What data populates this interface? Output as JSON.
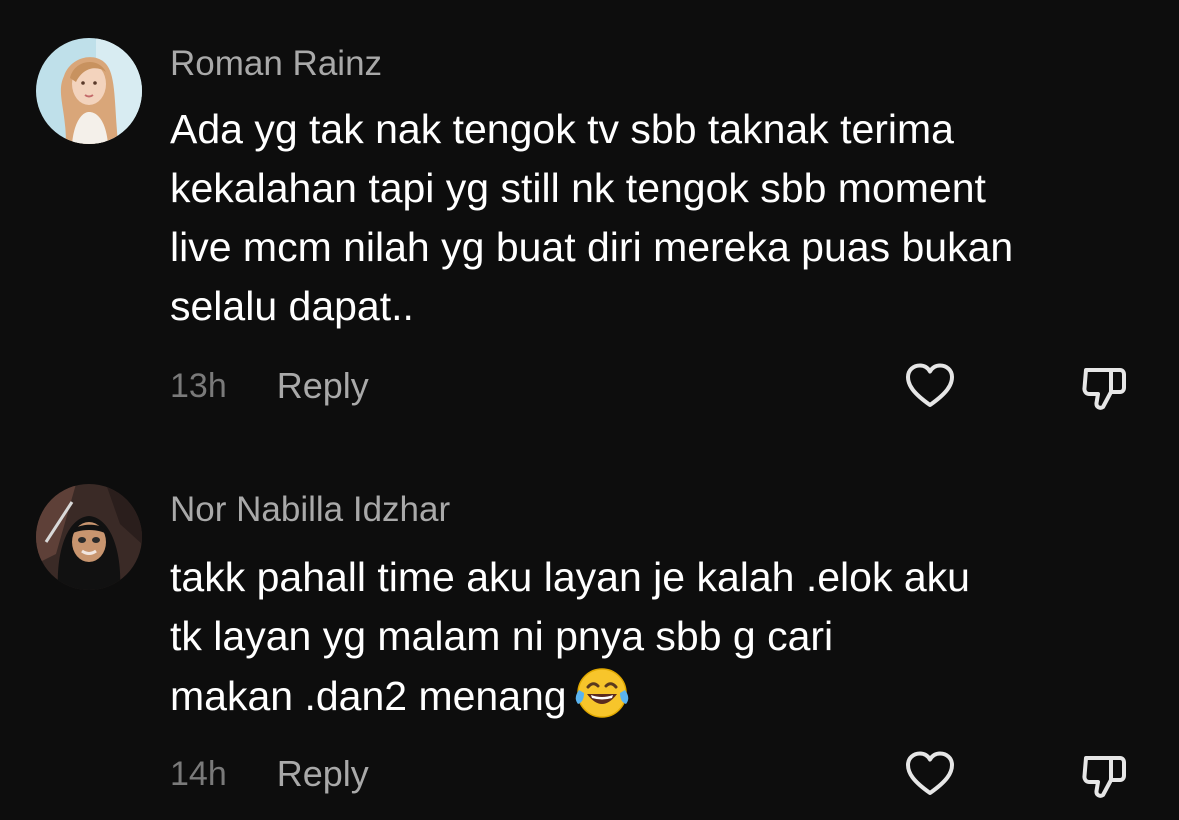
{
  "comments": [
    {
      "username": "Roman Rainz",
      "text_lines": [
        "Ada yg tak nak tengok tv sbb taknak terima",
        "kekalahan tapi yg still nk tengok sbb moment",
        "live mcm nilah yg buat diri mereka puas bukan",
        "selalu dapat.."
      ],
      "time": "13h",
      "reply_label": "Reply"
    },
    {
      "username": "Nor Nabilla Idzhar",
      "text_lines": [
        "takk pahall time aku layan je kalah .elok aku",
        "tk layan yg malam ni pnya sbb g cari",
        "makan .dan2 menang"
      ],
      "emoji": "face-with-tears-of-joy",
      "time": "14h",
      "reply_label": "Reply"
    }
  ],
  "icons": {
    "like": "heart-outline-icon",
    "dislike": "thumbs-down-outline-icon"
  },
  "colors": {
    "background": "#0d0d0d",
    "username": "#a9a9a9",
    "text": "#ffffff",
    "time": "#7a7a7a",
    "reply": "#a9a9a9",
    "icon": "#e6e6e6"
  }
}
